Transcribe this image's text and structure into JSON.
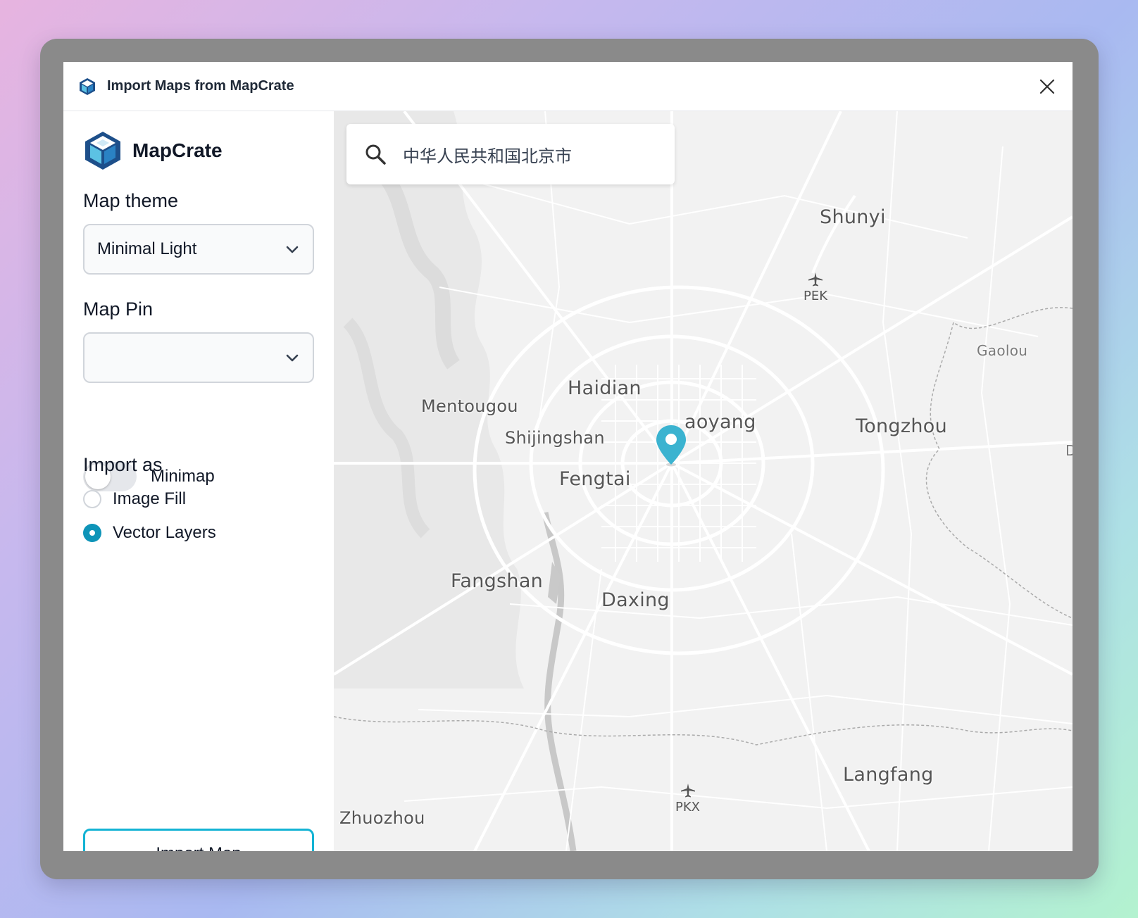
{
  "dialog": {
    "title": "Import Maps from MapCrate",
    "icons": {
      "app": "mapcrate-logo-icon",
      "close": "close-icon"
    }
  },
  "sidebar": {
    "brand_name": "MapCrate",
    "map_theme": {
      "label": "Map theme",
      "value": "Minimal Light"
    },
    "map_pin": {
      "label": "Map Pin",
      "value": ""
    },
    "minimap": {
      "label": "Minimap",
      "enabled": false
    },
    "import_as": {
      "label": "Import as",
      "options": [
        {
          "label": "Image Fill",
          "selected": false
        },
        {
          "label": "Vector Layers",
          "selected": true
        }
      ]
    },
    "import_button": "Import Map"
  },
  "map": {
    "search": {
      "value": "中华人民共和国北京市"
    },
    "places": {
      "shunyi": "Shunyi",
      "gaolou": "Gaolou",
      "haidian": "Haidian",
      "mentougou": "Mentougou",
      "chaoyang": "aoyang",
      "shijingshan": "Shijingshan",
      "tongzhou": "Tongzhou",
      "fengtai": "Fengtai",
      "fangshan": "Fangshan",
      "daxing": "Daxing",
      "langfang": "Langfang",
      "zhuozhou": "Zhuozhou",
      "edge_d": "D"
    },
    "airports": {
      "pek": "PEK",
      "pkx": "PKX"
    }
  },
  "colors": {
    "accent": "#13b3d4",
    "radio_selected": "#0e94b8",
    "pin": "#3bb3d0",
    "map_background": "#f2f2f2"
  }
}
